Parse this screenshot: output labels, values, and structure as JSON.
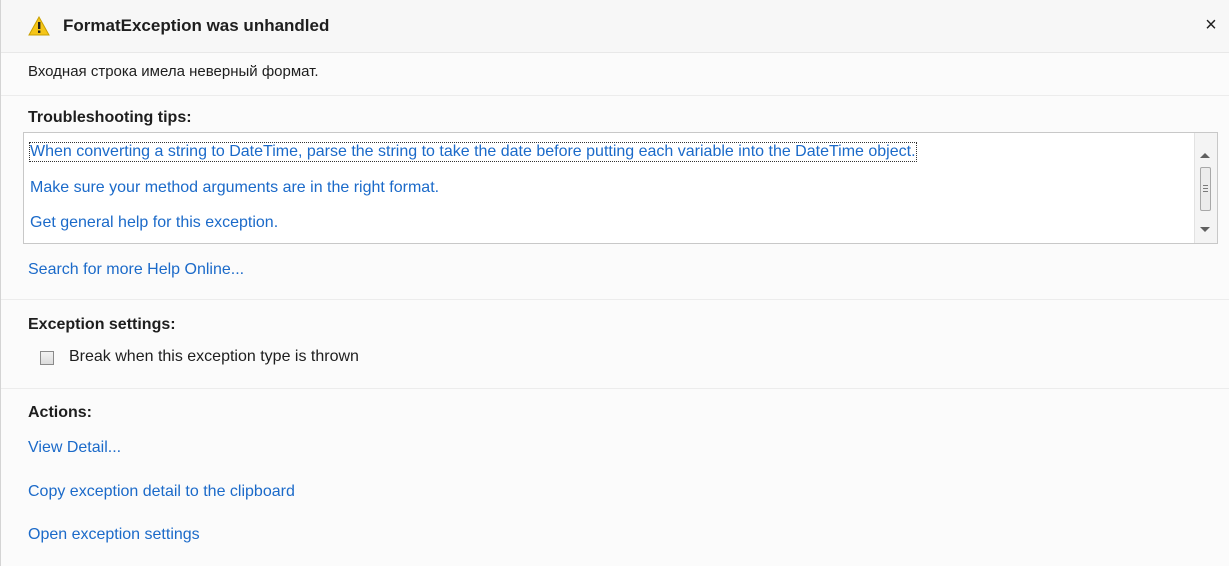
{
  "titlebar": {
    "icon": "warning-icon",
    "title": "FormatException was unhandled",
    "close_glyph": "×"
  },
  "message": "Входная строка имела неверный формат.",
  "troubleshooting": {
    "heading": "Troubleshooting tips:",
    "tips": [
      "When converting a string to DateTime, parse the string to take the date before putting each variable into the DateTime object.",
      "Make sure your method arguments are in the right format.",
      "Get general help for this exception."
    ],
    "search_link": "Search for more Help Online..."
  },
  "exception_settings": {
    "heading": "Exception settings:",
    "checkbox_label": "Break when this exception type is thrown",
    "checked": false
  },
  "actions": {
    "heading": "Actions:",
    "items": [
      "View Detail...",
      "Copy exception detail to the clipboard",
      "Open exception settings"
    ]
  },
  "colors": {
    "link": "#1b6ac9",
    "warning_fill": "#f5c518",
    "background": "#fbfbfb"
  }
}
